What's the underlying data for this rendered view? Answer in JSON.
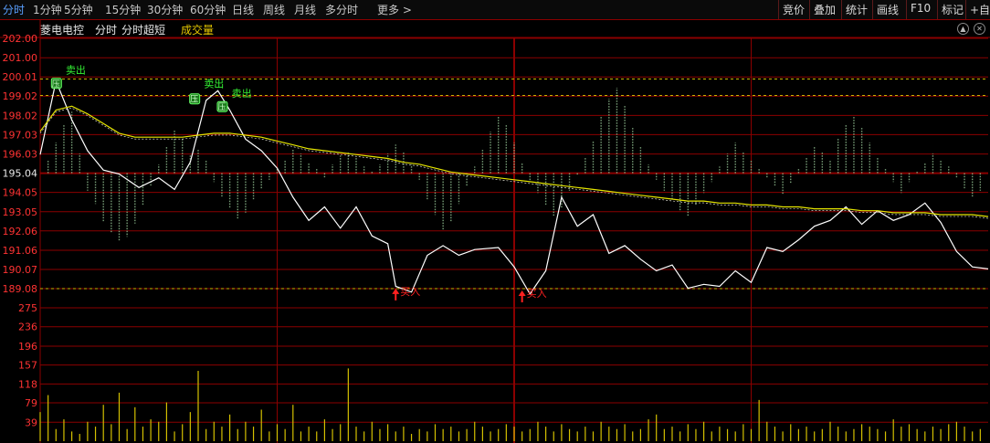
{
  "toolbar": {
    "tabs": [
      "分时",
      "1分钟",
      "5分钟",
      "15分钟",
      "30分钟",
      "60分钟",
      "日线",
      "周线",
      "月线",
      "多分时",
      "更多 >"
    ],
    "active_tab": 0,
    "tools": [
      "竞价",
      "叠加",
      "统计",
      "画线",
      "F10",
      "标记",
      "+自"
    ]
  },
  "subheader": {
    "stock_name": "菱电电控",
    "mode1": "分时",
    "mode2": "分时超短",
    "indicator": "成交量"
  },
  "colors": {
    "grid": "#8b0000",
    "price_line": "#ffffff",
    "avg_line": "#e6e600",
    "axis_text": "#ff3333",
    "volume": "#d4c000",
    "buy": "#ff2020",
    "sell": "#33ee33",
    "macd_bar": "#8fbc8f"
  },
  "chart_data": [
    {
      "type": "line",
      "name": "price",
      "y_ticks": [
        "202.00",
        "201.00",
        "200.01",
        "199.02",
        "198.02",
        "197.03",
        "196.03",
        "195.04",
        "194.05",
        "193.05",
        "192.06",
        "191.06",
        "190.07",
        "189.08"
      ],
      "ylim": [
        189.08,
        202.0
      ],
      "prev_close": 195.04,
      "n_points": 241,
      "series": [
        {
          "name": "price",
          "x": [
            0,
            4,
            8,
            12,
            16,
            20,
            25,
            30,
            34,
            38,
            42,
            45,
            48,
            52,
            56,
            60,
            64,
            68,
            72,
            76,
            80,
            84,
            88,
            90,
            94,
            98,
            102,
            106,
            110,
            116,
            120,
            124,
            128,
            132,
            136,
            140,
            144,
            148,
            152,
            156,
            160,
            164,
            168,
            172,
            176,
            180,
            184,
            188,
            192,
            196,
            200,
            204,
            208,
            212,
            216,
            220,
            224,
            228,
            232,
            236,
            240
          ],
          "y": [
            196.0,
            199.8,
            197.8,
            196.2,
            195.2,
            195.0,
            194.3,
            194.8,
            194.2,
            195.6,
            198.8,
            199.3,
            198.3,
            196.8,
            196.2,
            195.3,
            193.8,
            192.6,
            193.3,
            192.2,
            193.3,
            191.8,
            191.4,
            189.2,
            188.9,
            190.8,
            191.3,
            190.8,
            191.1,
            191.2,
            190.2,
            188.8,
            190.0,
            193.8,
            192.3,
            192.9,
            190.9,
            191.3,
            190.6,
            190.0,
            190.3,
            189.1,
            189.3,
            189.2,
            190.0,
            189.4,
            191.2,
            191.0,
            191.6,
            192.3,
            192.6,
            193.3,
            192.4,
            193.1,
            192.6,
            192.9,
            193.5,
            192.5,
            191.0,
            190.2,
            190.1
          ]
        },
        {
          "name": "avg",
          "x": [
            0,
            4,
            8,
            12,
            16,
            20,
            24,
            28,
            32,
            36,
            40,
            44,
            48,
            52,
            56,
            60,
            64,
            68,
            72,
            76,
            80,
            84,
            88,
            92,
            96,
            100,
            104,
            108,
            112,
            116,
            120,
            124,
            128,
            132,
            136,
            140,
            144,
            148,
            152,
            156,
            160,
            164,
            168,
            172,
            176,
            180,
            184,
            188,
            192,
            196,
            200,
            204,
            208,
            212,
            216,
            220,
            224,
            228,
            232,
            236,
            240
          ],
          "y": [
            197.2,
            198.3,
            198.5,
            198.1,
            197.6,
            197.1,
            196.9,
            196.9,
            196.9,
            196.9,
            197.0,
            197.1,
            197.1,
            197.0,
            196.9,
            196.7,
            196.5,
            196.3,
            196.2,
            196.1,
            196.0,
            195.9,
            195.8,
            195.6,
            195.5,
            195.3,
            195.1,
            195.0,
            194.9,
            194.8,
            194.7,
            194.6,
            194.5,
            194.4,
            194.3,
            194.2,
            194.1,
            194.0,
            193.9,
            193.8,
            193.7,
            193.6,
            193.6,
            193.5,
            193.5,
            193.4,
            193.4,
            193.3,
            193.3,
            193.2,
            193.2,
            193.2,
            193.1,
            193.1,
            193.0,
            193.0,
            193.0,
            192.9,
            192.9,
            192.9,
            192.8
          ]
        }
      ],
      "annotations": [
        {
          "label": "卖出",
          "x": 6,
          "y": 199.9,
          "side": "sell"
        },
        {
          "label": "卖出",
          "x": 41,
          "y": 199.2,
          "side": "sell"
        },
        {
          "label": "卖出",
          "x": 48,
          "y": 198.7,
          "side": "sell"
        },
        {
          "label": "买入",
          "x": 90,
          "y": 188.9,
          "side": "buy"
        },
        {
          "label": "买入",
          "x": 122,
          "y": 188.8,
          "side": "buy"
        }
      ],
      "markers": [
        {
          "label": "压",
          "x": 4,
          "y": 199.7
        },
        {
          "label": "压",
          "x": 39,
          "y": 198.9
        },
        {
          "label": "压",
          "x": 46,
          "y": 198.5
        }
      ]
    },
    {
      "type": "bar",
      "name": "volume",
      "y_ticks": [
        "275",
        "236",
        "196",
        "157",
        "118",
        "79",
        "39"
      ],
      "ylim": [
        0,
        275
      ],
      "x": [
        0,
        2,
        4,
        6,
        8,
        10,
        12,
        14,
        16,
        18,
        20,
        22,
        24,
        26,
        28,
        30,
        32,
        34,
        36,
        38,
        40,
        42,
        44,
        46,
        48,
        50,
        52,
        54,
        56,
        58,
        60,
        62,
        64,
        66,
        68,
        70,
        72,
        74,
        76,
        78,
        80,
        82,
        84,
        86,
        88,
        90,
        92,
        94,
        96,
        98,
        100,
        102,
        104,
        106,
        108,
        110,
        112,
        114,
        116,
        118,
        120,
        122,
        124,
        126,
        128,
        130,
        132,
        134,
        136,
        138,
        140,
        142,
        144,
        146,
        148,
        150,
        152,
        154,
        156,
        158,
        160,
        162,
        164,
        166,
        168,
        170,
        172,
        174,
        176,
        178,
        180,
        182,
        184,
        186,
        188,
        190,
        192,
        194,
        196,
        198,
        200,
        202,
        204,
        206,
        208,
        210,
        212,
        214,
        216,
        218,
        220,
        222,
        224,
        226,
        228,
        230,
        232,
        234,
        236,
        238
      ],
      "values": [
        60,
        95,
        25,
        45,
        20,
        15,
        40,
        30,
        75,
        35,
        100,
        25,
        70,
        30,
        45,
        40,
        80,
        20,
        35,
        60,
        145,
        25,
        40,
        30,
        55,
        25,
        40,
        30,
        65,
        20,
        35,
        25,
        75,
        20,
        30,
        20,
        45,
        25,
        35,
        150,
        30,
        20,
        40,
        25,
        35,
        20,
        30,
        15,
        25,
        20,
        35,
        25,
        30,
        20,
        25,
        40,
        30,
        20,
        25,
        35,
        30,
        20,
        25,
        40,
        30,
        20,
        35,
        25,
        20,
        30,
        20,
        40,
        30,
        25,
        35,
        20,
        25,
        45,
        55,
        25,
        30,
        20,
        35,
        25,
        40,
        20,
        30,
        25,
        20,
        35,
        25,
        85,
        40,
        30,
        20,
        35,
        25,
        30,
        20,
        25,
        40,
        30,
        20,
        25,
        35,
        30,
        25,
        20,
        45,
        30,
        35,
        25,
        20,
        30,
        25,
        35,
        40,
        30,
        20,
        25
      ]
    }
  ],
  "macd_bars": {
    "x": [
      2,
      4,
      6,
      8,
      10,
      12,
      14,
      16,
      18,
      20,
      22,
      24,
      26,
      28,
      30,
      32,
      34,
      36,
      38,
      40,
      42,
      44,
      46,
      48,
      50,
      52,
      54,
      56,
      58,
      60,
      62,
      64,
      66,
      68,
      70,
      72,
      74,
      76,
      78,
      80,
      82,
      84,
      86,
      88,
      90,
      92,
      94,
      96,
      98,
      100,
      102,
      104,
      106,
      108,
      110,
      112,
      114,
      116,
      118,
      120,
      122,
      124,
      126,
      128,
      130,
      132,
      134,
      136,
      138,
      140,
      142,
      144,
      146,
      148,
      150,
      152,
      154,
      156,
      158,
      160,
      162,
      164,
      166,
      168,
      170,
      172,
      174,
      176,
      178,
      180,
      182,
      184,
      186,
      188,
      190,
      192,
      194,
      196,
      198,
      200,
      202,
      204,
      206,
      208,
      210,
      212,
      214,
      216,
      218,
      220,
      222,
      224,
      226,
      228,
      230,
      232,
      234,
      236,
      238
    ],
    "values": [
      0.6,
      1.4,
      2.2,
      2.8,
      0.9,
      -0.8,
      -1.4,
      -2.2,
      -2.7,
      -3.1,
      -2.9,
      -2.3,
      -1.5,
      -0.6,
      0.4,
      1.2,
      2.0,
      1.6,
      0.8,
      1.1,
      0.6,
      -0.4,
      -1.1,
      -1.6,
      -2.1,
      -1.8,
      -1.2,
      -0.7,
      -0.3,
      0.2,
      0.6,
      1.1,
      0.9,
      0.5,
      0.2,
      -0.2,
      0.4,
      0.8,
      1.0,
      0.7,
      0.3,
      0.1,
      0.4,
      0.9,
      1.3,
      1.0,
      0.4,
      -0.3,
      -1.2,
      -1.9,
      -2.6,
      -2.2,
      -1.4,
      -0.6,
      0.3,
      1.1,
      1.9,
      2.6,
      2.2,
      1.4,
      0.5,
      -0.4,
      -0.9,
      -1.5,
      -2.0,
      -1.6,
      -0.8,
      -0.1,
      0.7,
      1.5,
      2.6,
      3.4,
      3.9,
      3.1,
      2.1,
      1.2,
      0.4,
      -0.3,
      -0.8,
      -1.2,
      -1.7,
      -2.0,
      -1.5,
      -0.9,
      -0.4,
      0.3,
      0.9,
      1.4,
      1.0,
      0.6,
      0.2,
      -0.2,
      -0.6,
      -1.0,
      -0.5,
      0.2,
      0.7,
      1.2,
      1.0,
      0.6,
      1.6,
      2.2,
      2.6,
      2.1,
      1.4,
      0.7,
      0.2,
      -0.4,
      -0.9,
      -0.4,
      0.1,
      0.5,
      0.9,
      0.6,
      0.3,
      -0.2,
      -0.7,
      -1.1,
      -0.8
    ]
  }
}
